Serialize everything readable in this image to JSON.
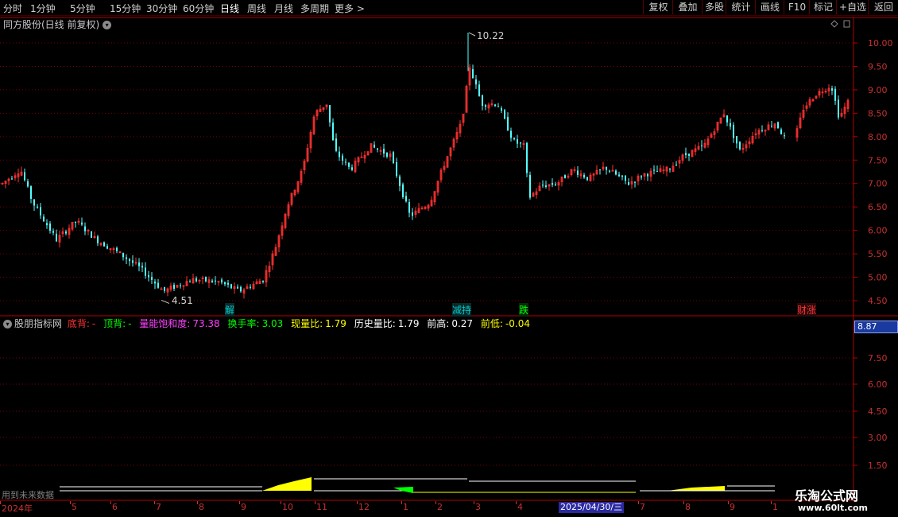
{
  "toolbar": {
    "periods": [
      "分时",
      "1分钟",
      "5分钟",
      "15分钟",
      "30分钟",
      "60分钟",
      "日线",
      "周线",
      "月线",
      "多周期",
      "更多 >"
    ],
    "active": "日线",
    "right_buttons": [
      "复权",
      "叠加",
      "多股",
      "统计",
      "画线",
      "F10",
      "标记",
      "+自选",
      "返回"
    ]
  },
  "stock_title": "同方股份(日线 前复权)",
  "main_axis_labels": [
    "10.00",
    "9.50",
    "9.00",
    "8.50",
    "8.00",
    "7.50",
    "7.00",
    "6.50",
    "6.00",
    "5.50",
    "5.00",
    "4.50"
  ],
  "annotations": {
    "high": "10.22",
    "low": "4.51",
    "events": [
      {
        "label": "解",
        "color": "#00c8c8"
      },
      {
        "label": "减持",
        "color": "#00c8c8"
      },
      {
        "label": "跌",
        "color": "#00ff00"
      },
      {
        "label": "财涨",
        "color": "#ff3232"
      }
    ]
  },
  "indicator": {
    "name": "股朋指标网",
    "items": [
      {
        "label": "底背:",
        "value": "-",
        "color": "#ff3232"
      },
      {
        "label": "顶背:",
        "value": "-",
        "color": "#00ff00"
      },
      {
        "label": "量能饱和度:",
        "value": "73.38",
        "color": "#ff40ff"
      },
      {
        "label": "换手率:",
        "value": "3.03",
        "color": "#00ff00"
      },
      {
        "label": "现量比:",
        "value": "1.79",
        "color": "#ffff00"
      },
      {
        "label": "历史量比:",
        "value": "1.79",
        "color": "#ffffff"
      },
      {
        "label": "前高:",
        "value": "0.27",
        "color": "#ffffff"
      },
      {
        "label": "前低:",
        "value": "-0.04",
        "color": "#ffff00"
      }
    ]
  },
  "sub_axis_labels": [
    "7.50",
    "6.00",
    "4.50",
    "3.00",
    "1.50"
  ],
  "current_price": "8.87",
  "bottom_note": "用到未来数据",
  "date_axis": [
    "2024年",
    "5",
    "6",
    "7",
    "8",
    "9",
    "10",
    "11",
    "12",
    "1",
    "2",
    "3",
    "4",
    "5",
    "7",
    "8",
    "9",
    "1"
  ],
  "cursor_date": "2025/04/30/三",
  "watermark": {
    "title": "乐淘公式网",
    "url": "www.60lt.com"
  },
  "colors": {
    "up": "#ff3232",
    "down": "#54ffff",
    "grid": "#7a0000",
    "axis": "#b40000"
  }
}
